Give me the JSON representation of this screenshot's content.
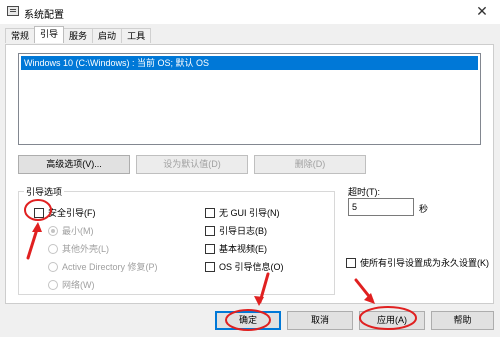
{
  "window": {
    "title": "系统配置",
    "close_glyph": "✕"
  },
  "tabs": [
    "常规",
    "引导",
    "服务",
    "启动",
    "工具"
  ],
  "os_list": {
    "items": [
      "Windows 10 (C:\\Windows) : 当前 OS; 默认 OS"
    ]
  },
  "boot_buttons": {
    "advanced": "高级选项(V)...",
    "set_default": "设为默认值(D)",
    "delete": "删除(D)"
  },
  "boot_options": {
    "legend": "引导选项",
    "safe_boot": "安全引导(F)",
    "minimal": "最小(M)",
    "alternate_shell": "其他外壳(L)",
    "active_directory_repair": "Active Directory 修复(P)",
    "network": "网络(W)",
    "no_gui_boot": "无 GUI 引导(N)",
    "boot_log": "引导日志(B)",
    "base_video": "基本视频(E)",
    "os_boot_info": "OS 引导信息(O)"
  },
  "timeout": {
    "label": "超时(T):",
    "value": "5",
    "unit": "秒"
  },
  "make_permanent": "使所有引导设置成为永久设置(K)",
  "dialog_buttons": {
    "ok": "确定",
    "cancel": "取消",
    "apply": "应用(A)",
    "help": "帮助"
  },
  "colors": {
    "selection": "#0078d7",
    "annotation": "#e02020"
  }
}
